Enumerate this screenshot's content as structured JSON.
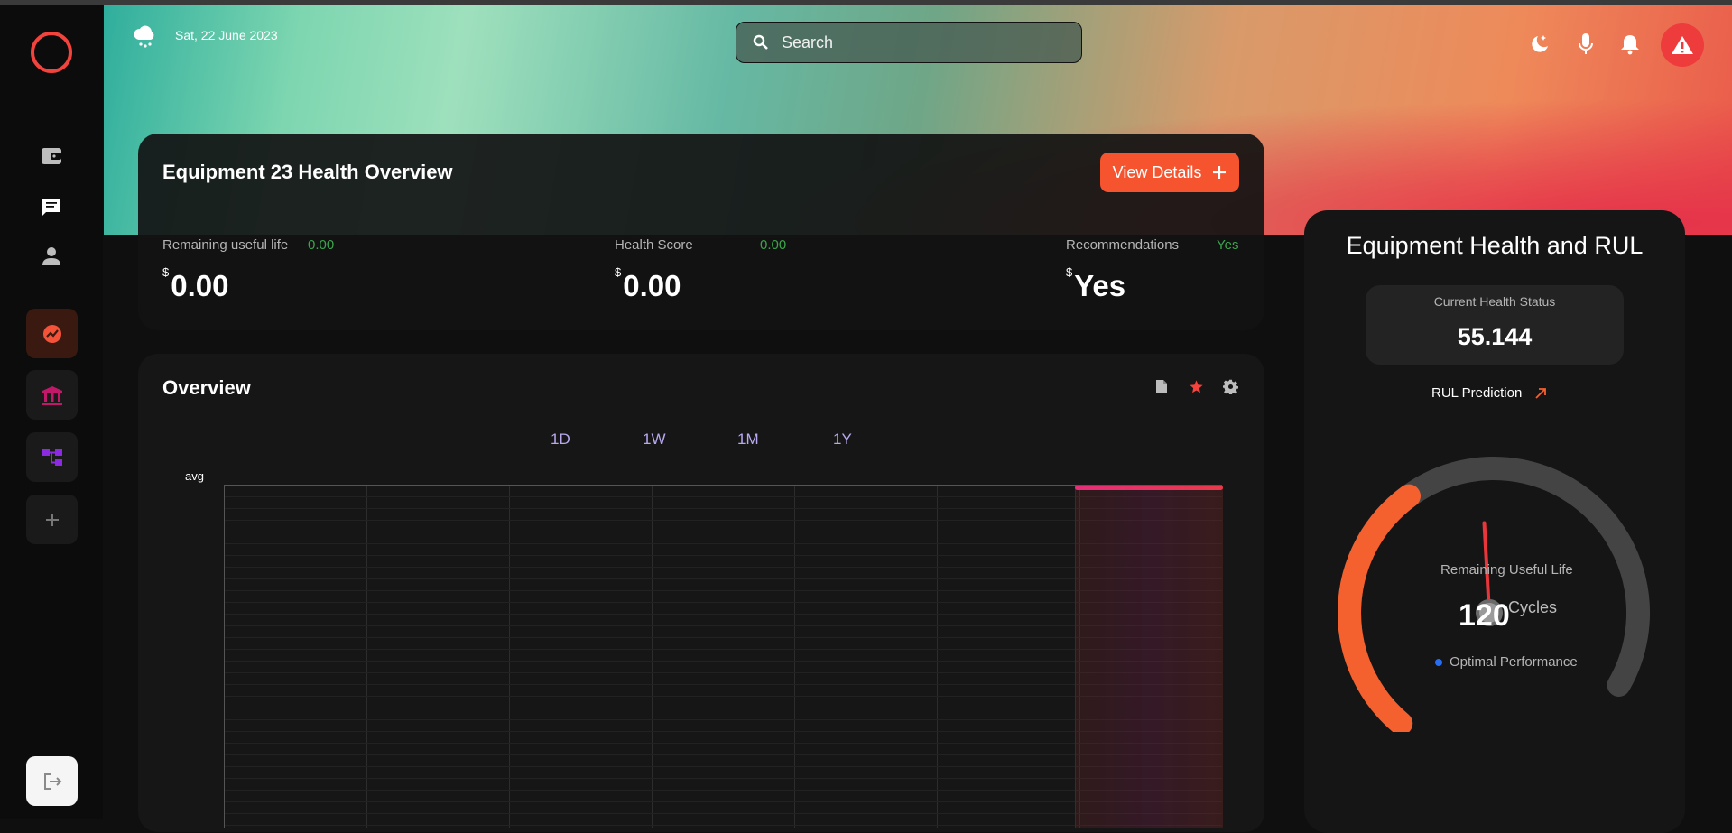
{
  "header": {
    "date": "Sat, 22 June 2023",
    "weather_icon": "cloud-snow-icon",
    "search_placeholder": "Search",
    "icons": [
      "moon-icon",
      "microphone-icon",
      "bell-icon",
      "alert-icon"
    ]
  },
  "sidebar": {
    "items": [
      {
        "icon": "wallet-icon"
      },
      {
        "icon": "chat-icon"
      },
      {
        "icon": "user-icon"
      },
      {
        "icon": "chart-icon",
        "active": true
      },
      {
        "icon": "bank-icon"
      },
      {
        "icon": "hierarchy-icon"
      },
      {
        "icon": "plus-icon"
      },
      {
        "icon": "logout-icon"
      }
    ]
  },
  "health_card": {
    "title": "Equipment 23 Health Overview",
    "view_button": "View Details",
    "metrics": [
      {
        "label": "Remaining useful life",
        "small": "0.00",
        "currency": "$",
        "value": "0.00"
      },
      {
        "label": "Health Score",
        "small": "0.00",
        "currency": "$",
        "value": "0.00"
      },
      {
        "label": "Recommendations",
        "small": "Yes",
        "currency": "$",
        "value": "Yes"
      }
    ]
  },
  "overview": {
    "title": "Overview",
    "icons": [
      "document-icon",
      "star-icon",
      "gear-icon"
    ],
    "ranges": [
      "1D",
      "1W",
      "1M",
      "1Y"
    ],
    "ylabel": "avg"
  },
  "chart_data": {
    "type": "line",
    "ylabel": "avg",
    "xlabel": "",
    "series": [
      {
        "values": []
      }
    ],
    "grid": true
  },
  "rul_card": {
    "title": "Equipment Health and RUL",
    "status_label": "Current Health Status",
    "status_value": "55.144",
    "prediction_label": "RUL Prediction",
    "gauge_label": "Remaining Useful Life",
    "gauge_value": "120",
    "gauge_unit": "Cycles",
    "gauge_status": "Optimal Performance",
    "gauge_fraction": 0.4,
    "colors": {
      "accent": "#f4602e",
      "track": "#444444",
      "needle": "#e8363a",
      "dot": "#2a6ef0"
    }
  }
}
